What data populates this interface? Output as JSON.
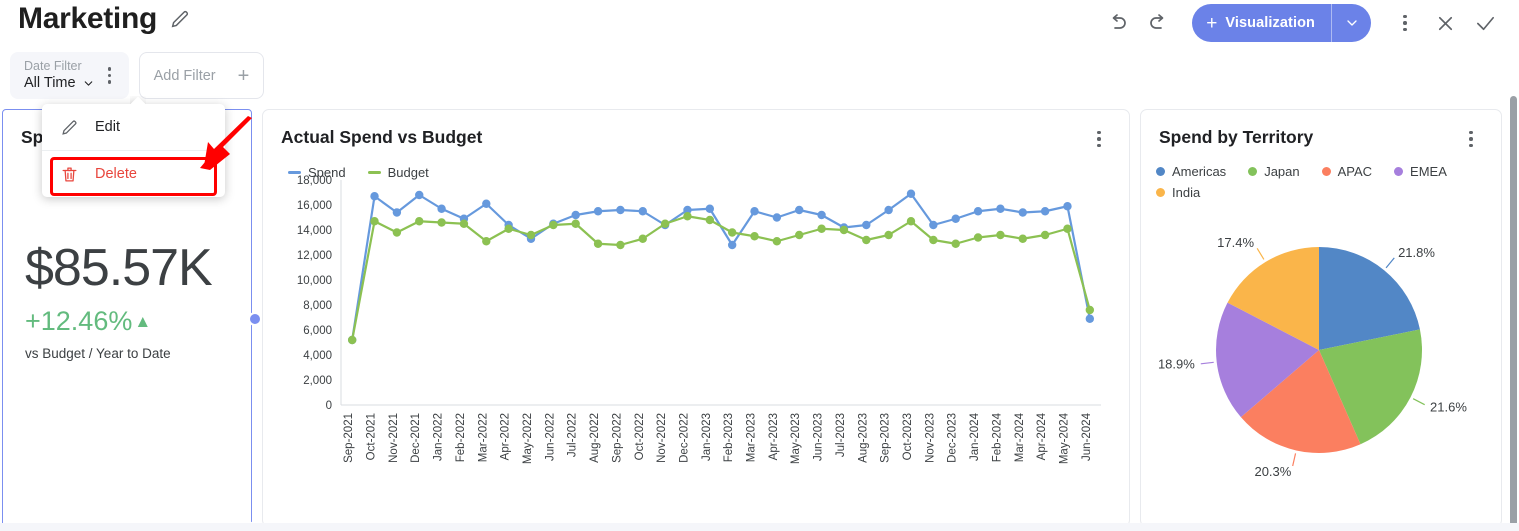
{
  "header": {
    "title": "Marketing",
    "edit_icon": "pencil-icon",
    "undo_icon": "undo-icon",
    "redo_icon": "redo-icon",
    "visualization_button": "Visualization",
    "visualization_plus": "+",
    "more_icon": "more-vertical-icon",
    "close_icon": "close-icon",
    "confirm_icon": "check-icon",
    "accent_color": "#6b82e8"
  },
  "filters": {
    "date_filter_label": "Date Filter",
    "date_filter_value": "All Time",
    "add_filter_label": "Add Filter",
    "add_filter_plus": "+"
  },
  "context_menu": {
    "items": [
      {
        "label": "Edit",
        "icon": "pencil-icon"
      },
      {
        "label": "Delete",
        "icon": "trash-icon"
      }
    ],
    "highlight_color": "#ff0000",
    "danger_color": "#e8453c"
  },
  "cards": {
    "kpi": {
      "title": "Spend",
      "value": "$85.57K",
      "delta": "+12.46%",
      "delta_arrow": "▲",
      "subtitle": "vs Budget / Year to Date",
      "delta_color": "#63bb7e",
      "selected": true
    },
    "line": {
      "title": "Actual Spend vs Budget",
      "more_icon": "more-vertical-icon"
    },
    "pie": {
      "title": "Spend by Territory",
      "more_icon": "more-vertical-icon"
    }
  },
  "chart_data": [
    {
      "type": "line",
      "title": "Actual Spend vs Budget",
      "xlabel": "",
      "ylabel": "",
      "ylim": [
        0,
        18000
      ],
      "yticks": [
        0,
        2000,
        4000,
        6000,
        8000,
        10000,
        12000,
        14000,
        16000,
        18000
      ],
      "ytick_labels": [
        "0",
        "2,000",
        "4,000",
        "6,000",
        "8,000",
        "10,000",
        "12,000",
        "14,000",
        "16,000",
        "18,000"
      ],
      "grid": false,
      "legend_position": "top-left",
      "categories": [
        "Sep-2021",
        "Oct-2021",
        "Nov-2021",
        "Dec-2021",
        "Jan-2022",
        "Feb-2022",
        "Mar-2022",
        "Apr-2022",
        "May-2022",
        "Jun-2022",
        "Jul-2022",
        "Aug-2022",
        "Sep-2022",
        "Oct-2022",
        "Nov-2022",
        "Dec-2022",
        "Jan-2023",
        "Feb-2023",
        "Mar-2023",
        "Apr-2023",
        "May-2023",
        "Jun-2023",
        "Jul-2023",
        "Aug-2023",
        "Sep-2023",
        "Oct-2023",
        "Nov-2023",
        "Dec-2023",
        "Jan-2024",
        "Feb-2024",
        "Mar-2024",
        "Apr-2024",
        "May-2024",
        "Jun-2024"
      ],
      "series": [
        {
          "name": "Spend",
          "color": "#6699dd",
          "values": [
            5200,
            16700,
            15400,
            16800,
            15700,
            14900,
            16100,
            14400,
            13300,
            14500,
            15200,
            15500,
            15600,
            15500,
            14400,
            15600,
            15700,
            12800,
            15500,
            15000,
            15600,
            15200,
            14200,
            14400,
            15600,
            16900,
            14400,
            14900,
            15500,
            15700,
            15400,
            15500,
            15900,
            6900
          ]
        },
        {
          "name": "Budget",
          "color": "#8cc152",
          "values": [
            5200,
            14700,
            13800,
            14700,
            14600,
            14500,
            13100,
            14100,
            13600,
            14400,
            14500,
            12900,
            12800,
            13300,
            14500,
            15100,
            14800,
            13800,
            13500,
            13100,
            13600,
            14100,
            14000,
            13200,
            13600,
            14700,
            13200,
            12900,
            13400,
            13600,
            13300,
            13600,
            14100,
            7600
          ]
        }
      ]
    },
    {
      "type": "pie",
      "title": "Spend by Territory",
      "legend_position": "top",
      "labels": [
        "Americas",
        "Japan",
        "APAC",
        "EMEA",
        "India"
      ],
      "values": [
        21.8,
        21.6,
        20.3,
        18.9,
        17.4
      ],
      "value_labels": [
        "21.8%",
        "21.6%",
        "20.3%",
        "18.9%",
        "17.4%"
      ],
      "colors": [
        "#5287c6",
        "#83c25b",
        "#fb7f60",
        "#a67fdd",
        "#fab54a"
      ]
    }
  ]
}
